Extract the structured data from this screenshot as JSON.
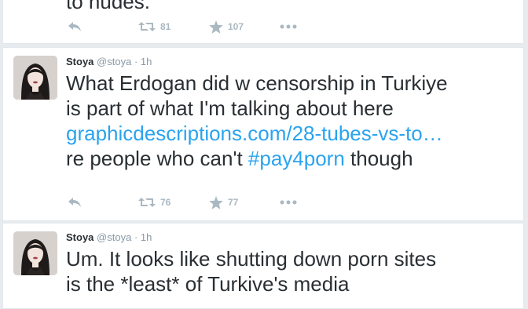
{
  "tweets": [
    {
      "partial_text": "to nudes.",
      "retweets": "81",
      "favorites": "107"
    },
    {
      "name": "Stoya",
      "handle": "@stoya",
      "sep": "·",
      "time": "1h",
      "lines": [
        "What Erdogan did w censorship in Turkiye",
        "is part of what I'm talking about here"
      ],
      "link": "graphicdescriptions.com/28-tubes-vs-to…",
      "line4_prefix": "re people who can't ",
      "hashtag": "#pay4porn",
      "line4_suffix": " though",
      "retweets": "76",
      "favorites": "77"
    },
    {
      "name": "Stoya",
      "handle": "@stoya",
      "sep": "·",
      "time": "1h",
      "lines": [
        "Um. It looks like shutting down porn sites",
        "is the *least* of Turkive's media"
      ]
    }
  ],
  "colors": {
    "link": "#2aa3ef",
    "text": "#292f33",
    "meta": "#8899a6",
    "icon": "#aab8c2"
  },
  "icons": {
    "reply": "reply-icon",
    "retweet": "retweet-icon",
    "favorite": "star-icon",
    "more": "more-dots-icon"
  }
}
